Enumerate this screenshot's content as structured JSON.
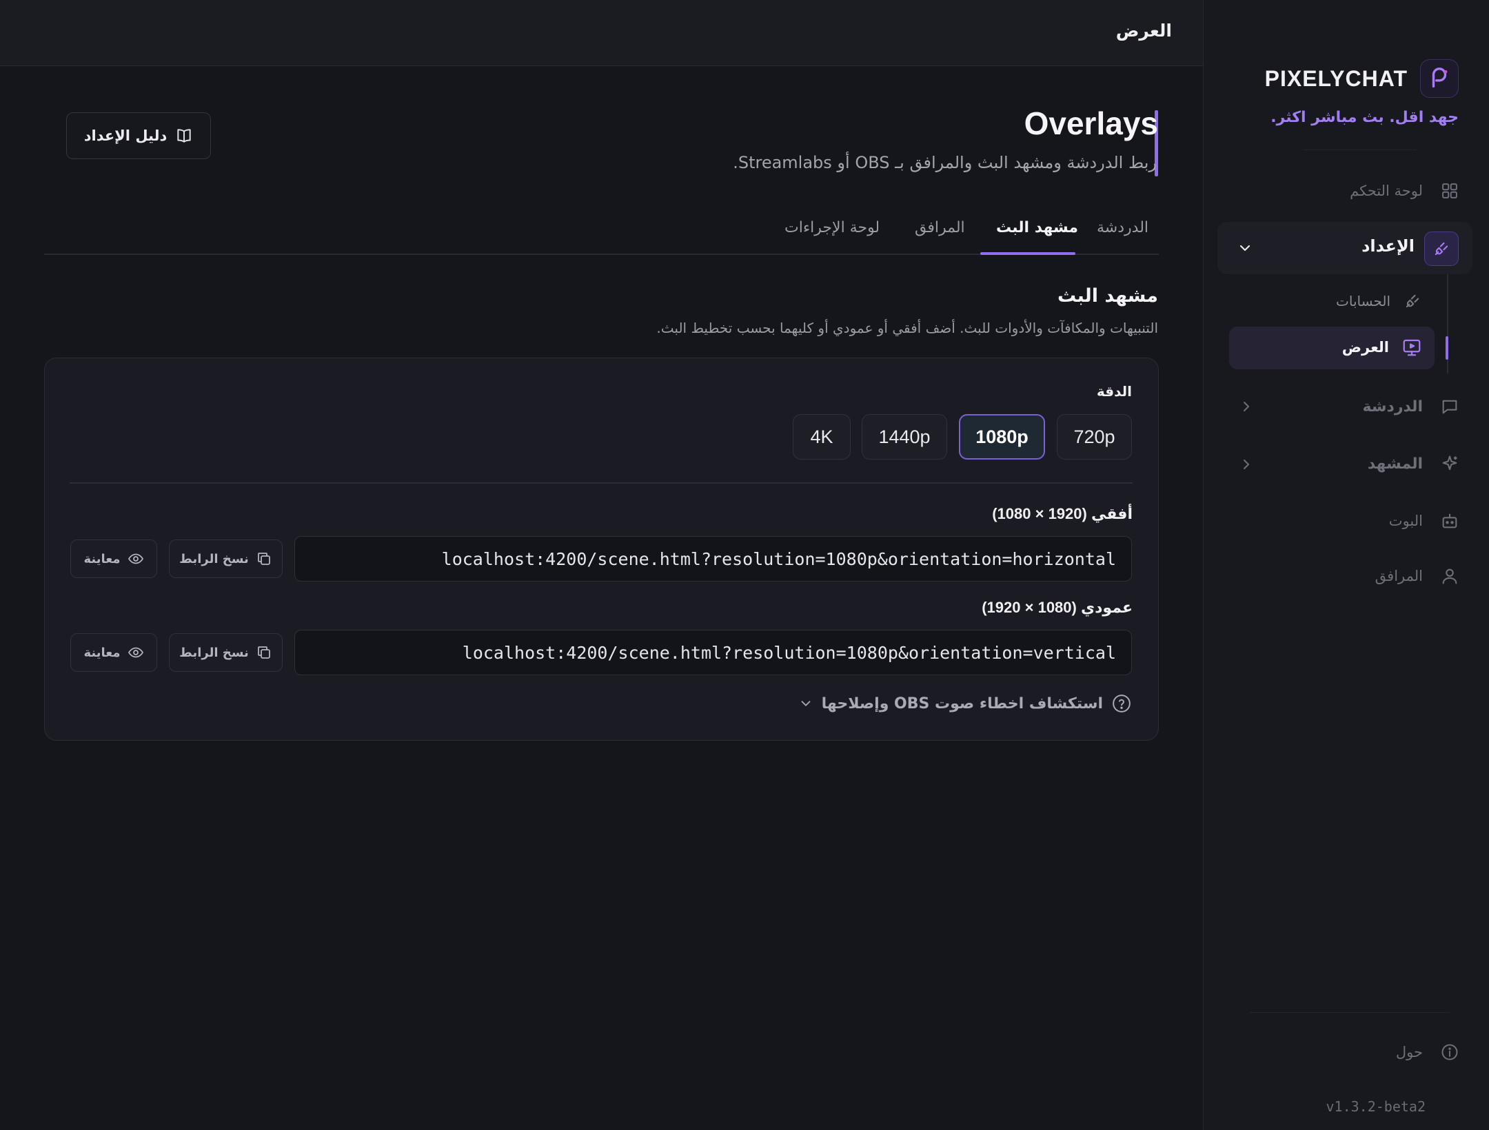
{
  "sidebar": {
    "brand": "PIXELYCHAT",
    "tagline": "جهد اقل. بث مباشر اكثر.",
    "items": [
      {
        "label": "لوحة التحكم",
        "icon": "grid-icon"
      },
      {
        "label": "الإعداد",
        "icon": "plug-icon"
      },
      {
        "label": "الدردشة",
        "icon": "chat-icon"
      },
      {
        "label": "المشهد",
        "icon": "sparkle-icon"
      },
      {
        "label": "البوت",
        "icon": "bot-icon"
      },
      {
        "label": "المرافق",
        "icon": "user-icon"
      }
    ],
    "sub_items": [
      {
        "label": "الحسابات",
        "icon": "plug-icon"
      },
      {
        "label": "العرض",
        "icon": "monitor-icon"
      }
    ],
    "about": "حول",
    "version": "v1.3.2-beta2"
  },
  "header": {
    "title": "العرض"
  },
  "main": {
    "title": "Overlays",
    "subtitle": "ربط الدردشة ومشهد البث والمرافق بـ OBS أو Streamlabs.",
    "guide_button": "دليل الإعداد",
    "tabs": [
      {
        "label": "الدردشة"
      },
      {
        "label": "مشهد البث"
      },
      {
        "label": "المرافق"
      },
      {
        "label": "لوحة الإجراءات"
      }
    ],
    "active_tab": "مشهد البث",
    "section_title": "مشهد البث",
    "section_subtitle": "التنبيهات والمكافآت والأدوات للبث. أضف أفقي أو عمودي أو كليهما بحسب تخطيط البث.",
    "resolution": {
      "label": "الدقة",
      "options": [
        "720p",
        "1080p",
        "1440p",
        "4K"
      ],
      "selected": "1080p"
    },
    "horizontal": {
      "label": "أفقي (1920 × 1080)",
      "url": "localhost:4200/scene.html?resolution=1080p&orientation=horizontal"
    },
    "vertical": {
      "label": "عمودي (1080 × 1920)",
      "url": "localhost:4200/scene.html?resolution=1080p&orientation=vertical"
    },
    "copy_label": "نسخ الرابط",
    "preview_label": "معاينة",
    "troubleshoot": "استكشاف اخطاء صوت OBS وإصلاحها"
  },
  "colors": {
    "accent": "#8f6cf0",
    "background": "#15161b",
    "sidebar": "#18191f"
  }
}
